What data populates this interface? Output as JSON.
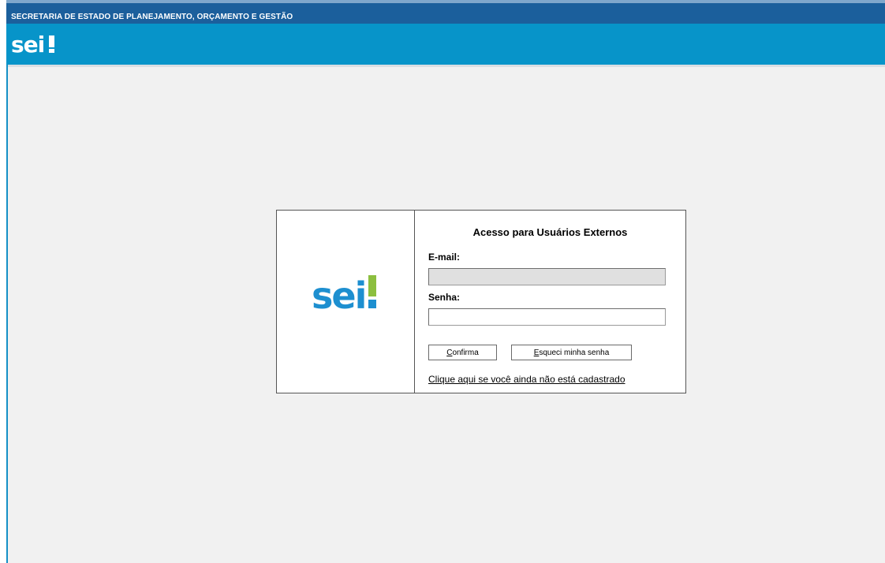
{
  "topbar": {
    "org_name": "SECRETARIA DE ESTADO DE PLANEJAMENTO, ORÇAMENTO E GESTÃO"
  },
  "header": {
    "logo_text": "sei!"
  },
  "login": {
    "title": "Acesso para Usuários Externos",
    "email_label": "E-mail:",
    "email_value": "",
    "senha_label": "Senha:",
    "senha_value": "",
    "confirma_label_accesskey": "C",
    "confirma_label_rest": "onfirma",
    "esqueci_label_accesskey": "E",
    "esqueci_label_rest": "squeci minha senha",
    "register_link": "Clique aqui se você ainda não está cadastrado"
  },
  "colors": {
    "topbar": "#1b5f9c",
    "header": "#0794c9",
    "logo_blue": "#1d8fd0",
    "logo_green": "#8cbf3f",
    "content_bg": "#f1f1f1"
  }
}
